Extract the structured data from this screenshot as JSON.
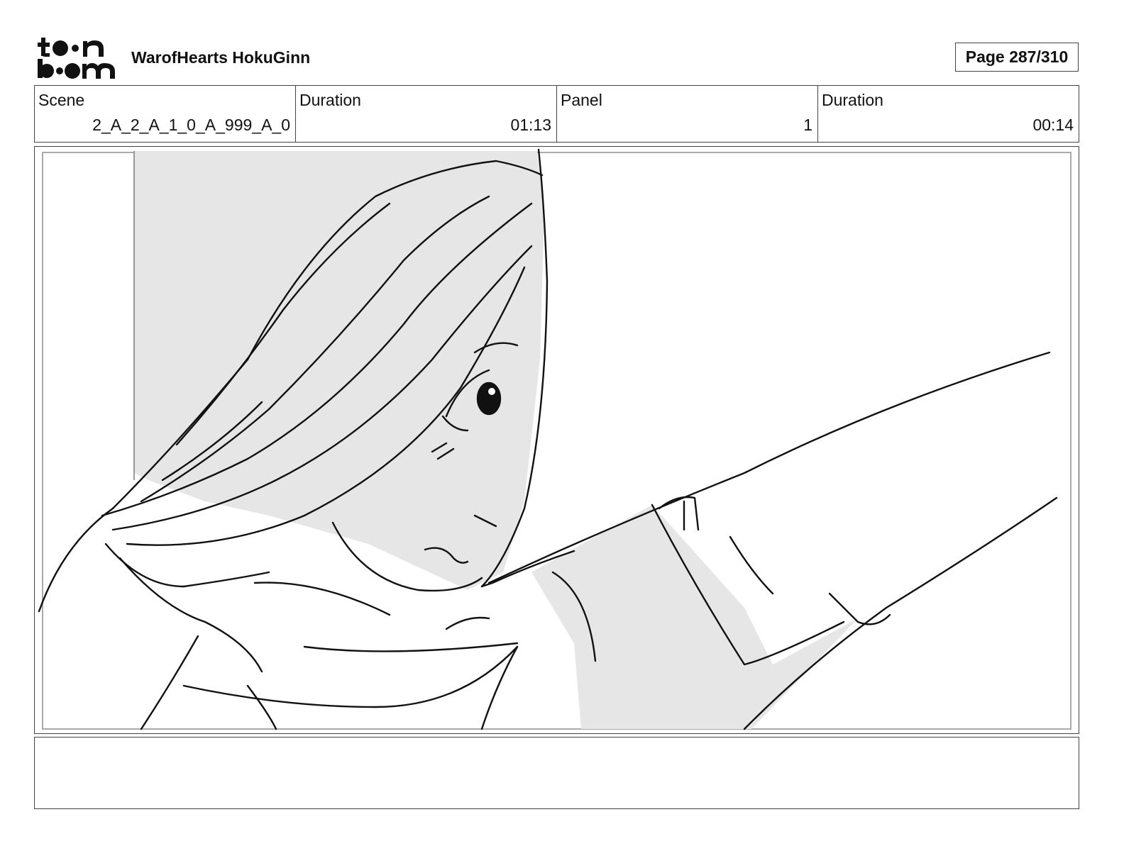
{
  "header": {
    "logo": {
      "icon": "toonboom-logo",
      "line1": "toon",
      "line2": "boom"
    },
    "project_title": "WarofHearts HokuGinn",
    "page_indicator": "Page 287/310"
  },
  "info": {
    "scene_label": "Scene",
    "scene_value": "2_A_2_A_1_0_A_999_A_0",
    "scene_duration_label": "Duration",
    "scene_duration_value": "01:13",
    "panel_label": "Panel",
    "panel_value": "1",
    "panel_duration_label": "Duration",
    "panel_duration_value": "00:14"
  },
  "panel": {
    "image": "storyboard-sketch",
    "subject": "girl-with-long-hair-reaching-arm",
    "shade_color": "#e6e6e6",
    "line_color": "#111111"
  },
  "notes": {
    "text": ""
  }
}
